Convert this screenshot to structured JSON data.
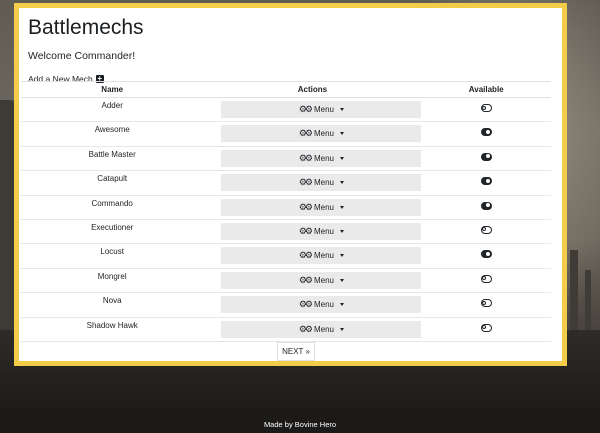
{
  "header": {
    "title": "Battlemechs",
    "welcome": "Welcome Commander!",
    "add_mech_label": "Add a New Mech",
    "add_icon": "plus-square-icon"
  },
  "table": {
    "columns": [
      "Name",
      "Actions",
      "Available"
    ],
    "menu_label": "Menu",
    "menu_icon": "cogs-icon",
    "rows": [
      {
        "name": "Adder",
        "available": false
      },
      {
        "name": "Awesome",
        "available": true
      },
      {
        "name": "Battle Master",
        "available": true
      },
      {
        "name": "Catapult",
        "available": true
      },
      {
        "name": "Commando",
        "available": true
      },
      {
        "name": "Executioner",
        "available": false
      },
      {
        "name": "Locust",
        "available": true
      },
      {
        "name": "Mongrel",
        "available": false
      },
      {
        "name": "Nova",
        "available": false
      },
      {
        "name": "Shadow Hawk",
        "available": false
      }
    ]
  },
  "pagination": {
    "next_label": "NEXT",
    "next_icon": "»"
  },
  "footer": {
    "credit": "Made by Bovine Hero"
  },
  "colors": {
    "frame": "#f3cd4a",
    "menu_bg": "#eaeaea",
    "footer_bg": "#1b1a19"
  }
}
